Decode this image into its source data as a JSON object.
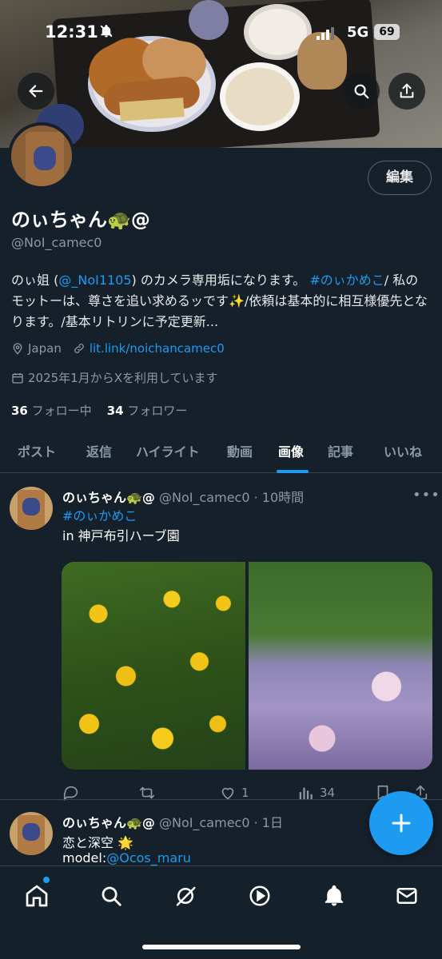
{
  "status_bar": {
    "time": "12:31",
    "network": "5G",
    "battery": "69"
  },
  "profile": {
    "name": "のぃちゃん🐢@",
    "handle": "@NoI_camec0",
    "edit_label": "編集",
    "bio": {
      "p1": "のぃ姐 (",
      "mention": "@_NoI1105",
      "p2": ") のカメラ専用垢になります。 ",
      "hashtag": "#のぃかめこ",
      "p3": "/ 私のモットーは、尊さを追い求めるッです✨/依頼は基本的に相互様優先となります。/基本リトリンに予定更新..."
    },
    "location": "Japan",
    "website": "lit.link/noichancamec0",
    "joined": "2025年1月からXを利用しています",
    "following_count": "36",
    "following_label": "フォロー中",
    "followers_count": "34",
    "followers_label": "フォロワー"
  },
  "tabs": [
    "ポスト",
    "返信",
    "ハイライト",
    "動画",
    "画像",
    "記事",
    "いいね"
  ],
  "active_tab": "画像",
  "posts": [
    {
      "name": "のぃちゃん🐢@",
      "handle": "@NoI_camec0",
      "time": "· 10時間",
      "more": "•••",
      "hashtag": "#のぃかめこ",
      "line2": "in 神戸布引ハーブ園",
      "likes": "1",
      "views": "34"
    },
    {
      "name": "のぃちゃん🐢@",
      "handle": "@NoI_camec0",
      "time": "· 1日",
      "line1": "恋と深空 🌟",
      "model_prefix": "model:",
      "model_mention": "@Ocos_maru"
    }
  ],
  "colors": {
    "accent": "#1d9bf0",
    "background": "#15202b",
    "muted": "#8b98a5"
  }
}
